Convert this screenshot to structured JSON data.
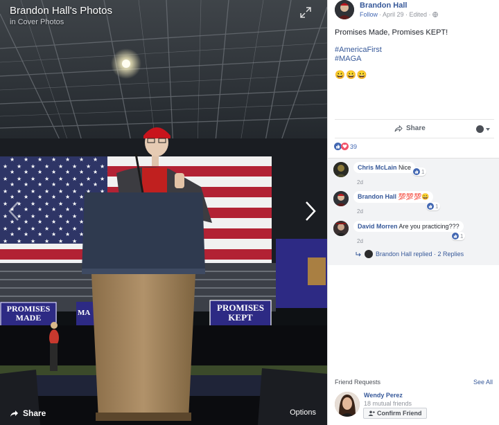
{
  "viewer": {
    "title": "Brandon Hall's Photos",
    "album": "in Cover Photos",
    "share_label": "Share",
    "options_label": "Options",
    "banner_left": "PROMISES MADE",
    "banner_left_1": "PROMISES",
    "banner_left_2": "MADE",
    "banner_right_1": "PROMISES",
    "banner_right_2": "KEPT",
    "banner_mid": "MA"
  },
  "post": {
    "author": "Brandon Hall",
    "follow": "Follow",
    "date_line": "· April 29 · Edited ·",
    "text": "Promises Made, Promises KEPT!",
    "hashtags": [
      "#AmericaFirst",
      "#MAGA"
    ],
    "emojis": "😀😀😀",
    "share_label": "Share",
    "reaction_count": "39"
  },
  "comments": [
    {
      "name": "Chris McLain",
      "text": "Nice",
      "time": "2d",
      "likes": "1"
    },
    {
      "name": "Brandon Hall",
      "text": "💯💯💯😀",
      "time": "2d",
      "likes": "1"
    },
    {
      "name": "David Morren",
      "text": "Are you practicing???",
      "time": "2d",
      "likes": "1"
    }
  ],
  "replies": {
    "text": "Brandon Hall replied · 2 Replies"
  },
  "friend_requests": {
    "heading": "Friend Requests",
    "see_all": "See All",
    "name": "Wendy Perez",
    "mutual": "18 mutual friends",
    "confirm": "Confirm Friend"
  },
  "colors": {
    "link": "#365899",
    "accent": "#4267b2",
    "flag_red": "#b22234",
    "flag_blue": "#3c3b6e",
    "banner_blue": "#2d2a84"
  }
}
